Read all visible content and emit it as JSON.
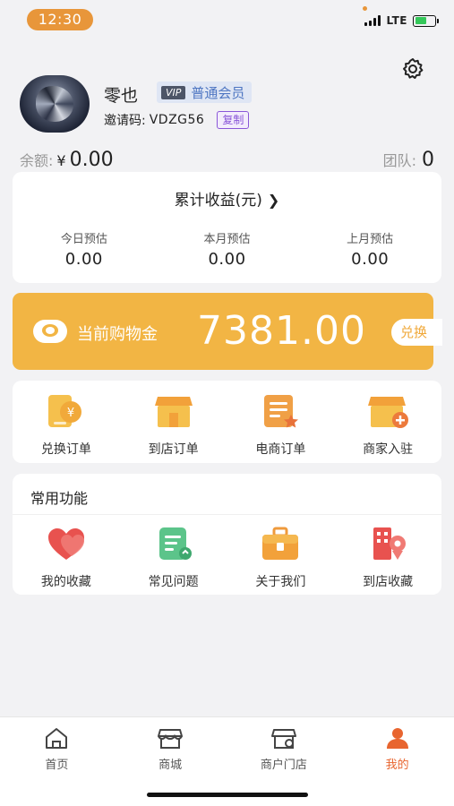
{
  "status_bar": {
    "time": "12:30",
    "network": "LTE"
  },
  "profile": {
    "name": "零也",
    "vip_tag": "VIP",
    "member_level": "普通会员",
    "invite_label": "邀请码:",
    "invite_code": "VDZG56",
    "copy_label": "复制",
    "balance_label": "余额:",
    "currency": "¥",
    "balance": "0.00",
    "team_label": "团队:",
    "team_count": "0"
  },
  "earnings": {
    "title": "累计收益(元)",
    "items": [
      {
        "label": "今日预估",
        "value": "0.00"
      },
      {
        "label": "本月预估",
        "value": "0.00"
      },
      {
        "label": "上月预估",
        "value": "0.00"
      }
    ]
  },
  "shopping_gold": {
    "label": "当前购物金",
    "amount": "7381.00",
    "button": "兑换"
  },
  "orders": [
    {
      "label": "兑换订单",
      "icon": "exchange-order-icon"
    },
    {
      "label": "到店订单",
      "icon": "store-order-icon"
    },
    {
      "label": "电商订单",
      "icon": "ecommerce-order-icon"
    },
    {
      "label": "商家入驻",
      "icon": "merchant-join-icon"
    }
  ],
  "common_functions": {
    "title": "常用功能",
    "items": [
      {
        "label": "我的收藏",
        "icon": "heart-icon"
      },
      {
        "label": "常见问题",
        "icon": "faq-icon"
      },
      {
        "label": "关于我们",
        "icon": "briefcase-icon"
      },
      {
        "label": "到店收藏",
        "icon": "building-location-icon"
      }
    ]
  },
  "tabs": [
    {
      "label": "首页",
      "icon": "home-icon"
    },
    {
      "label": "商城",
      "icon": "mall-icon"
    },
    {
      "label": "商户门店",
      "icon": "merchant-store-icon"
    },
    {
      "label": "我的",
      "icon": "user-icon",
      "active": true
    }
  ],
  "colors": {
    "accent": "#f2b544",
    "active_tab": "#e8652f",
    "vip_text": "#4e76c2",
    "copy": "#8a56d8"
  }
}
